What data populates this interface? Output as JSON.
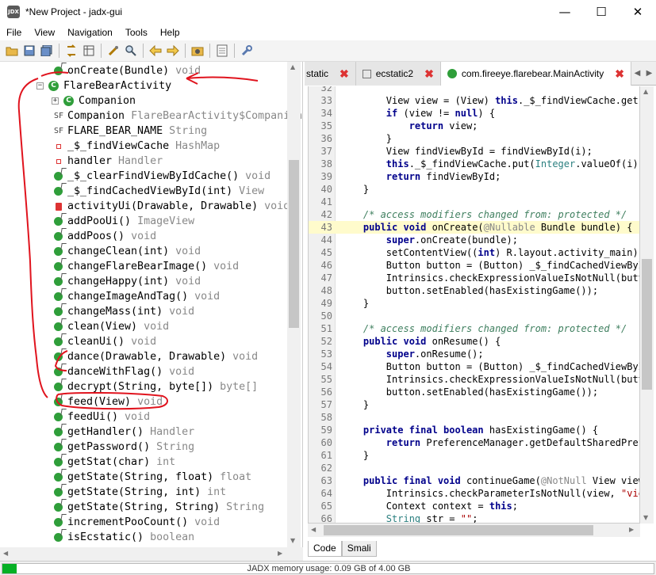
{
  "window": {
    "title": "*New Project - jadx-gui",
    "app_icon_label": "JDX",
    "minimize": "—",
    "maximize": "☐",
    "close": "✕"
  },
  "menu": [
    "File",
    "View",
    "Navigation",
    "Tools",
    "Help"
  ],
  "toolbar_icons": [
    "open-icon",
    "save-icon",
    "save-all-icon",
    "sync-icon",
    "flatten-icon",
    "decompile-icon",
    "search-icon",
    "back-icon",
    "forward-icon",
    "deobfuscation-icon",
    "log-icon",
    "preferences-icon"
  ],
  "tree": {
    "rows": [
      {
        "kind": "m",
        "name": "onCreate(Bundle)",
        "type": "void",
        "indent": 85
      },
      {
        "kind": "cls",
        "name": "FlareBearActivity",
        "type": "",
        "indent": 63,
        "expander": "−"
      },
      {
        "kind": "cls",
        "name": "Companion",
        "type": "",
        "indent": 82,
        "expander": "+"
      },
      {
        "kind": "sf",
        "name": "Companion",
        "type": "FlareBearActivity$Companion",
        "indent": 85
      },
      {
        "kind": "sf",
        "name": "FLARE_BEAR_NAME",
        "type": "String",
        "indent": 85
      },
      {
        "kind": "f",
        "name": "_$_findViewCache",
        "type": "HashMap",
        "indent": 85
      },
      {
        "kind": "f",
        "name": "handler",
        "type": "Handler",
        "indent": 85
      },
      {
        "kind": "m",
        "name": "_$_clearFindViewByIdCache()",
        "type": "void",
        "indent": 85
      },
      {
        "kind": "m",
        "name": "_$_findCachedViewById(int)",
        "type": "View",
        "indent": 85
      },
      {
        "kind": "am",
        "name": "activityUi(Drawable, Drawable)",
        "type": "void",
        "indent": 85
      },
      {
        "kind": "m",
        "name": "addPooUi()",
        "type": "ImageView",
        "indent": 85
      },
      {
        "kind": "m",
        "name": "addPoos()",
        "type": "void",
        "indent": 85
      },
      {
        "kind": "m",
        "name": "changeClean(int)",
        "type": "void",
        "indent": 85
      },
      {
        "kind": "m",
        "name": "changeFlareBearImage()",
        "type": "void",
        "indent": 85
      },
      {
        "kind": "m",
        "name": "changeHappy(int)",
        "type": "void",
        "indent": 85
      },
      {
        "kind": "m",
        "name": "changeImageAndTag()",
        "type": "void",
        "indent": 85
      },
      {
        "kind": "m",
        "name": "changeMass(int)",
        "type": "void",
        "indent": 85
      },
      {
        "kind": "m",
        "name": "clean(View)",
        "type": "void",
        "indent": 85
      },
      {
        "kind": "m",
        "name": "cleanUi()",
        "type": "void",
        "indent": 85
      },
      {
        "kind": "m",
        "name": "dance(Drawable, Drawable)",
        "type": "void",
        "indent": 85
      },
      {
        "kind": "m",
        "name": "danceWithFlag()",
        "type": "void",
        "indent": 85
      },
      {
        "kind": "m",
        "name": "decrypt(String, byte[])",
        "type": "byte[]",
        "indent": 85
      },
      {
        "kind": "m",
        "name": "feed(View)",
        "type": "void",
        "indent": 85
      },
      {
        "kind": "m",
        "name": "feedUi()",
        "type": "void",
        "indent": 85
      },
      {
        "kind": "m",
        "name": "getHandler()",
        "type": "Handler",
        "indent": 85
      },
      {
        "kind": "m",
        "name": "getPassword()",
        "type": "String",
        "indent": 85
      },
      {
        "kind": "m",
        "name": "getStat(char)",
        "type": "int",
        "indent": 85
      },
      {
        "kind": "m",
        "name": "getState(String, float)",
        "type": "float",
        "indent": 85
      },
      {
        "kind": "m",
        "name": "getState(String, int)",
        "type": "int",
        "indent": 85
      },
      {
        "kind": "m",
        "name": "getState(String, String)",
        "type": "String",
        "indent": 85
      },
      {
        "kind": "m",
        "name": "incrementPooCount()",
        "type": "void",
        "indent": 85
      },
      {
        "kind": "m",
        "name": "isEcstatic()",
        "type": "boolean",
        "indent": 85
      }
    ]
  },
  "tabs": [
    {
      "label": "static",
      "icon": "none",
      "active": false
    },
    {
      "label": "ecstatic2",
      "icon": "file",
      "active": false
    },
    {
      "label": "com.fireeye.flarebear.MainActivity",
      "icon": "class",
      "active": true
    }
  ],
  "tab_close": "✖",
  "tab_nav": [
    "◀",
    "▶"
  ],
  "code": [
    {
      "n": "32",
      "html": "        <span class=\"ty\"></span>"
    },
    {
      "n": "33",
      "html": "        View view = (View) <span class=\"kw\">this</span>._$_findViewCache.get(I"
    },
    {
      "n": "34",
      "html": "        <span class=\"kw\">if</span> (view != <span class=\"kw\">null</span>) {"
    },
    {
      "n": "35",
      "html": "            <span class=\"kw\">return</span> view;"
    },
    {
      "n": "36",
      "html": "        }"
    },
    {
      "n": "37",
      "html": "        View findViewById = findViewById(i);"
    },
    {
      "n": "38",
      "html": "        <span class=\"kw\">this</span>._$_findViewCache.put(<span class=\"ty\">Integer</span>.valueOf(i),"
    },
    {
      "n": "39",
      "html": "        <span class=\"kw\">return</span> findViewById;"
    },
    {
      "n": "40",
      "html": "    }"
    },
    {
      "n": "41",
      "html": ""
    },
    {
      "n": "42",
      "html": "    <span class=\"cm\">/* access modifiers changed from: protected */</span>"
    },
    {
      "n": "43",
      "html": "    <span class=\"kw\">public void</span> onCreate(<span class=\"an\">@Nullable</span> Bundle bundle) {",
      "hl": true
    },
    {
      "n": "44",
      "html": "        <span class=\"kw\">super</span>.onCreate(bundle);"
    },
    {
      "n": "45",
      "html": "        setContentView((<span class=\"kw\">int</span>) R.layout.activity_main);"
    },
    {
      "n": "46",
      "html": "        Button button = (Button) _$_findCachedViewById"
    },
    {
      "n": "47",
      "html": "        Intrinsics.checkExpressionValueIsNotNull(butto"
    },
    {
      "n": "48",
      "html": "        button.setEnabled(hasExistingGame());"
    },
    {
      "n": "49",
      "html": "    }"
    },
    {
      "n": "50",
      "html": ""
    },
    {
      "n": "51",
      "html": "    <span class=\"cm\">/* access modifiers changed from: protected */</span>"
    },
    {
      "n": "52",
      "html": "    <span class=\"kw\">public void</span> onResume() {"
    },
    {
      "n": "53",
      "html": "        <span class=\"kw\">super</span>.onResume();"
    },
    {
      "n": "54",
      "html": "        Button button = (Button) _$_findCachedViewById"
    },
    {
      "n": "55",
      "html": "        Intrinsics.checkExpressionValueIsNotNull(butto"
    },
    {
      "n": "56",
      "html": "        button.setEnabled(hasExistingGame());"
    },
    {
      "n": "57",
      "html": "    }"
    },
    {
      "n": "58",
      "html": ""
    },
    {
      "n": "59",
      "html": "    <span class=\"kw\">private final boolean</span> hasExistingGame() {"
    },
    {
      "n": "60",
      "html": "        <span class=\"kw\">return</span> PreferenceManager.getDefaultSharedPrefe"
    },
    {
      "n": "61",
      "html": "    }"
    },
    {
      "n": "62",
      "html": ""
    },
    {
      "n": "63",
      "html": "    <span class=\"kw\">public final void</span> continueGame(<span class=\"an\">@NotNull</span> View view)"
    },
    {
      "n": "64",
      "html": "        Intrinsics.checkParameterIsNotNull(view, <span class=\"st\">\"view</span>"
    },
    {
      "n": "65",
      "html": "        Context context = <span class=\"kw\">this</span>;"
    },
    {
      "n": "66",
      "html": "        <span class=\"ty\">String</span> str = <span class=\"st\">\"\"</span>;"
    }
  ],
  "bottom_tabs": [
    "Code",
    "Smali"
  ],
  "status": {
    "memory_text": "JADX memory usage: 0.09 GB of 4.00 GB",
    "memory_fraction": 0.0225
  }
}
